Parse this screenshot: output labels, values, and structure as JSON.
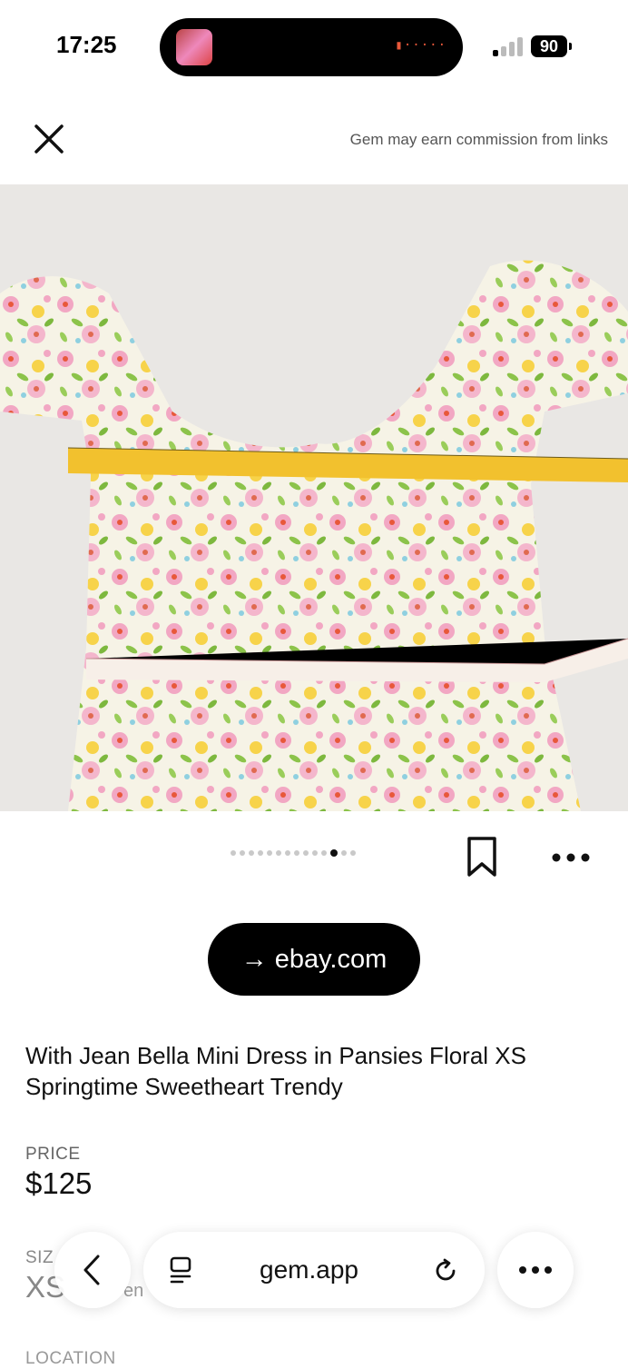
{
  "status_bar": {
    "time": "17:25",
    "battery": "90"
  },
  "header": {
    "commission_note": "Gem may earn commission from links"
  },
  "product": {
    "link_label": "ebay.com",
    "title": "With Jean Bella Mini Dress in Pansies Floral XS Springtime Sweetheart Trendy",
    "price_label": "PRICE",
    "price": "$125",
    "size_label": "SIZ",
    "size_value": "XS",
    "size_extra": "en",
    "location_label": "LOCATION"
  },
  "carousel": {
    "total": 14,
    "active_index": 11
  },
  "browser": {
    "url": "gem.app"
  },
  "colors": {
    "accent": "#000000",
    "tape_yellow": "#f2c12e",
    "dress_pink": "#f2a7c3",
    "dress_green": "#8cc34a"
  }
}
